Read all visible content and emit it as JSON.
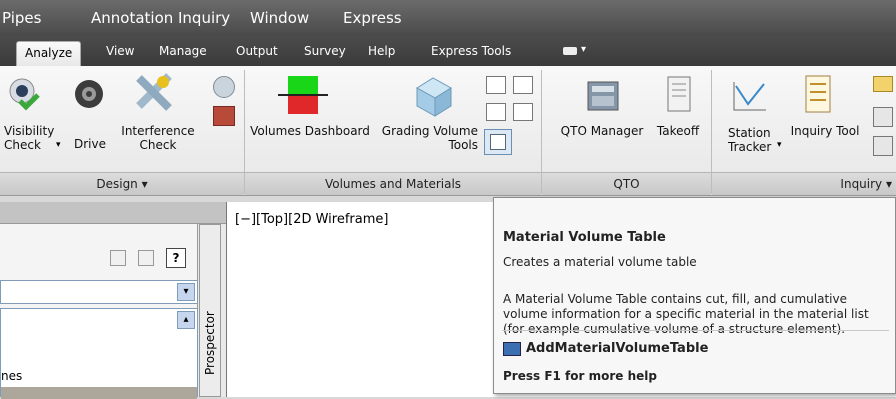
{
  "menubar": {
    "items": [
      "Pipes",
      "Annotation",
      "Inquiry",
      "Window",
      "Express"
    ]
  },
  "tabs": {
    "items": [
      "Analyze",
      "View",
      "Manage",
      "Output",
      "Survey",
      "Help",
      "Express Tools"
    ],
    "active": "Analyze"
  },
  "ribbon": {
    "design": {
      "visibility_check": "Visibility\nCheck",
      "drive": "Drive",
      "interference_check": "Interference\nCheck",
      "panel_label": "Design ▾"
    },
    "volumes": {
      "volumes_dashboard": "Volumes Dashboard",
      "grading_volume_tools": "Grading Volume\nTools",
      "panel_label": "Volumes and Materials"
    },
    "qto": {
      "qto_manager": "QTO Manager",
      "takeoff": "Takeoff",
      "panel_label": "QTO"
    },
    "inquiry": {
      "station_tracker": "Station\nTracker",
      "inquiry_tool": "Inquiry Tool",
      "panel_label": "Inquiry ▾"
    }
  },
  "left_panel": {
    "help_icon_label": "?",
    "list_item": "nes",
    "prospector_label": "Prospector"
  },
  "viewport": {
    "label": "[−][Top][2D Wireframe]"
  },
  "tooltip": {
    "title": "Material Volume Table",
    "subtitle": "Creates a material volume table",
    "description": "A Material Volume Table contains cut, fill, and cumulative volume information for a specific material in the material list (for example cumulative volume of a structure element).",
    "command": "AddMaterialVolumeTable",
    "help": "Press F1 for more help"
  }
}
